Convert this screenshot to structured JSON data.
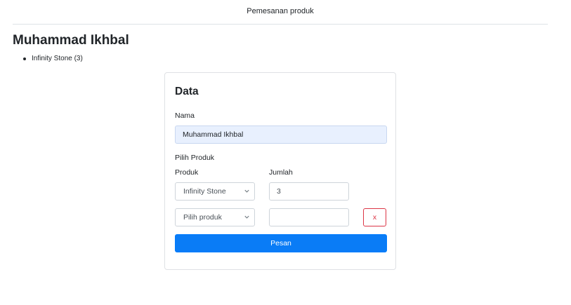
{
  "header": {
    "title": "Pemesanan produk"
  },
  "customer": {
    "name": "Muhammad Ikhbal",
    "orders": [
      {
        "label": "Infinity Stone (3)"
      }
    ]
  },
  "form": {
    "title": "Data",
    "name_label": "Nama",
    "name_value": "Muhammad Ikhbal",
    "section_label": "Pilih Produk",
    "product_col_label": "Produk",
    "qty_col_label": "Jumlah",
    "rows": [
      {
        "product": "Infinity Stone",
        "qty": "3"
      },
      {
        "product": "Pilih produk",
        "qty": ""
      }
    ],
    "remove_label": "x",
    "submit_label": "Pesan"
  },
  "icons": {
    "select_arrow": "chevron-down-icon",
    "list_marker": "bullet-icon"
  },
  "colors": {
    "primary": "#0a7cf6",
    "danger": "#dc3545",
    "autofill": "#e8f0fe"
  }
}
